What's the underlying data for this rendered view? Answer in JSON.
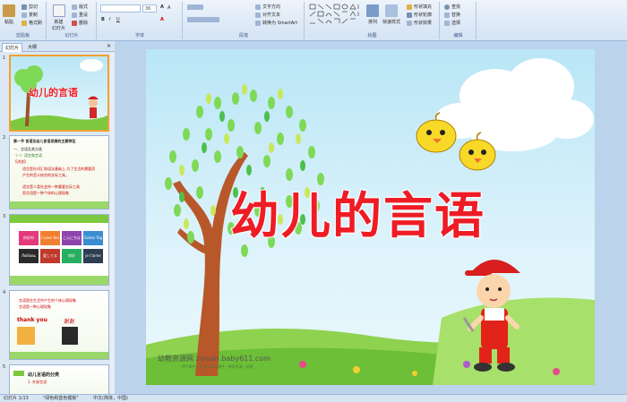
{
  "ribbon": {
    "clipboard": {
      "paste": "粘贴",
      "cut": "剪切",
      "copy": "复制",
      "format_painter": "格式刷",
      "label": "剪贴板"
    },
    "slides": {
      "new_slide": "新建\n幻灯片",
      "layout": "版式",
      "reset": "重设",
      "delete": "删除",
      "label": "幻灯片"
    },
    "font": {
      "font_size": "36",
      "label": "字体"
    },
    "paragraph": {
      "text_direction": "文字方向",
      "align_text": "对齐文本",
      "smartart": "转换为 SmartArt",
      "label": "段落"
    },
    "drawing": {
      "arrange": "排列",
      "quick_styles": "快速样式",
      "shape_fill": "形状填充",
      "shape_outline": "形状轮廓",
      "shape_effects": "形状效果",
      "label": "绘图"
    },
    "editing": {
      "find": "查找",
      "replace": "替换",
      "select": "选择",
      "label": "编辑"
    }
  },
  "panel_tabs": {
    "slides": "幻灯片",
    "outline": "大纲"
  },
  "thumbnails": [
    {
      "num": "1",
      "title": "幼儿的言语"
    },
    {
      "num": "2",
      "lines": [
        "第一节 言语及幼儿言语发展的主要特征",
        "一、言语及其分类",
        "（一）语言和言语",
        "【讲述】",
        "语言是在词汇和语法基础上,为了生活的需要而",
        "产生的音义结合的交际工具。",
        "语言是人类社会的一种重要交际工具",
        "而言语是一种个体的心理现象"
      ]
    },
    {
      "num": "3",
      "cells": [
        "你好吗",
        "I Love You",
        "こんにちは",
        "Guten Tag",
        "Любовь",
        "愛してる",
        "你好",
        "je t'aime"
      ]
    },
    {
      "num": "4",
      "lines": [
        "言语是在生活中产生的个体心理现象",
        "言语是一种心理现象",
        "thank you",
        "谢谢"
      ]
    },
    {
      "num": "5",
      "lines": [
        "幼儿言语的分类",
        "1. 外部言语"
      ]
    }
  ],
  "slide": {
    "title": "幼儿的言语",
    "watermark": "幼教资源网 ziyuan.baby611.com",
    "watermark_sub": "PPT课件 · 幼儿FLASH课件 · 教学资源 · 试卷"
  },
  "status": {
    "slide_indicator": "幻灯片 1/13",
    "theme": "\"绿色和蓝色模板\"",
    "language": "中文(简体，中国)"
  },
  "colors": {
    "title_red": "#ee1c25",
    "ribbon_bg": "#d4e3f4",
    "sky": "#b9e6f6",
    "grass": "#7cc93f"
  }
}
